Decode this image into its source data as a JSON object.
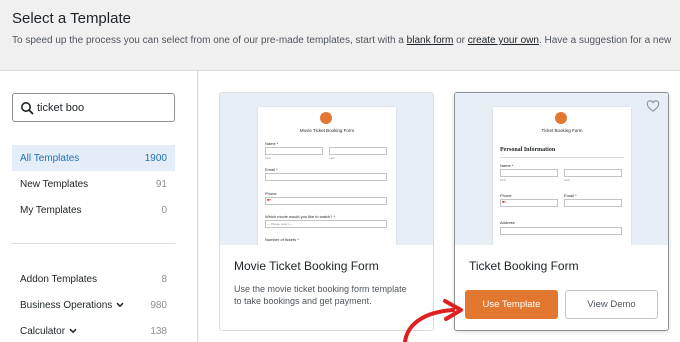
{
  "header": {
    "title": "Select a Template",
    "subtitle_before": "To speed up the process you can select from one of our pre-made templates, start with a ",
    "blank_form_link": "blank form",
    "subtitle_or": " or ",
    "create_own_link": "create your own",
    "subtitle_after": ". Have a suggestion for a new"
  },
  "search": {
    "value": "ticket boo",
    "icon": "search-icon"
  },
  "categories": [
    {
      "label": "All Templates",
      "count": "1900",
      "active": true
    },
    {
      "label": "New Templates",
      "count": "91"
    },
    {
      "label": "My Templates",
      "count": "0"
    },
    {
      "label": "Addon Templates",
      "count": "8"
    },
    {
      "label": "Business Operations",
      "count": "980",
      "chevron": "chevron-down-icon"
    },
    {
      "label": "Calculator",
      "count": "138",
      "chevron": "chevron-down-icon"
    }
  ],
  "cards": [
    {
      "title": "Movie Ticket Booking Form",
      "description": "Use the movie ticket booking form template to take bookings and get payment.",
      "preview": {
        "form_title": "Movie Ticket Booking Form",
        "name_label": "Name *",
        "first": "First",
        "last": "Last",
        "email_label": "Email *",
        "phone_label": "Phone",
        "movie_label": "Which movie would you like to watch? *",
        "movie_placeholder": "--- Please select ---",
        "seats_label": "Number of tickets *"
      }
    },
    {
      "title": "Ticket Booking Form",
      "buttons": {
        "use": "Use Template",
        "demo": "View Demo"
      },
      "preview": {
        "form_title": "Ticket Booking Form",
        "section": "Personal Information",
        "name_label": "Name *",
        "first": "First",
        "last": "Last",
        "phone_label": "Phone",
        "email_label": "Email *",
        "address_label": "Address"
      }
    }
  ],
  "colors": {
    "accent": "#e27730",
    "active_bg": "#e5eef8",
    "link": "#2271b1",
    "arrow": "#e02020"
  }
}
